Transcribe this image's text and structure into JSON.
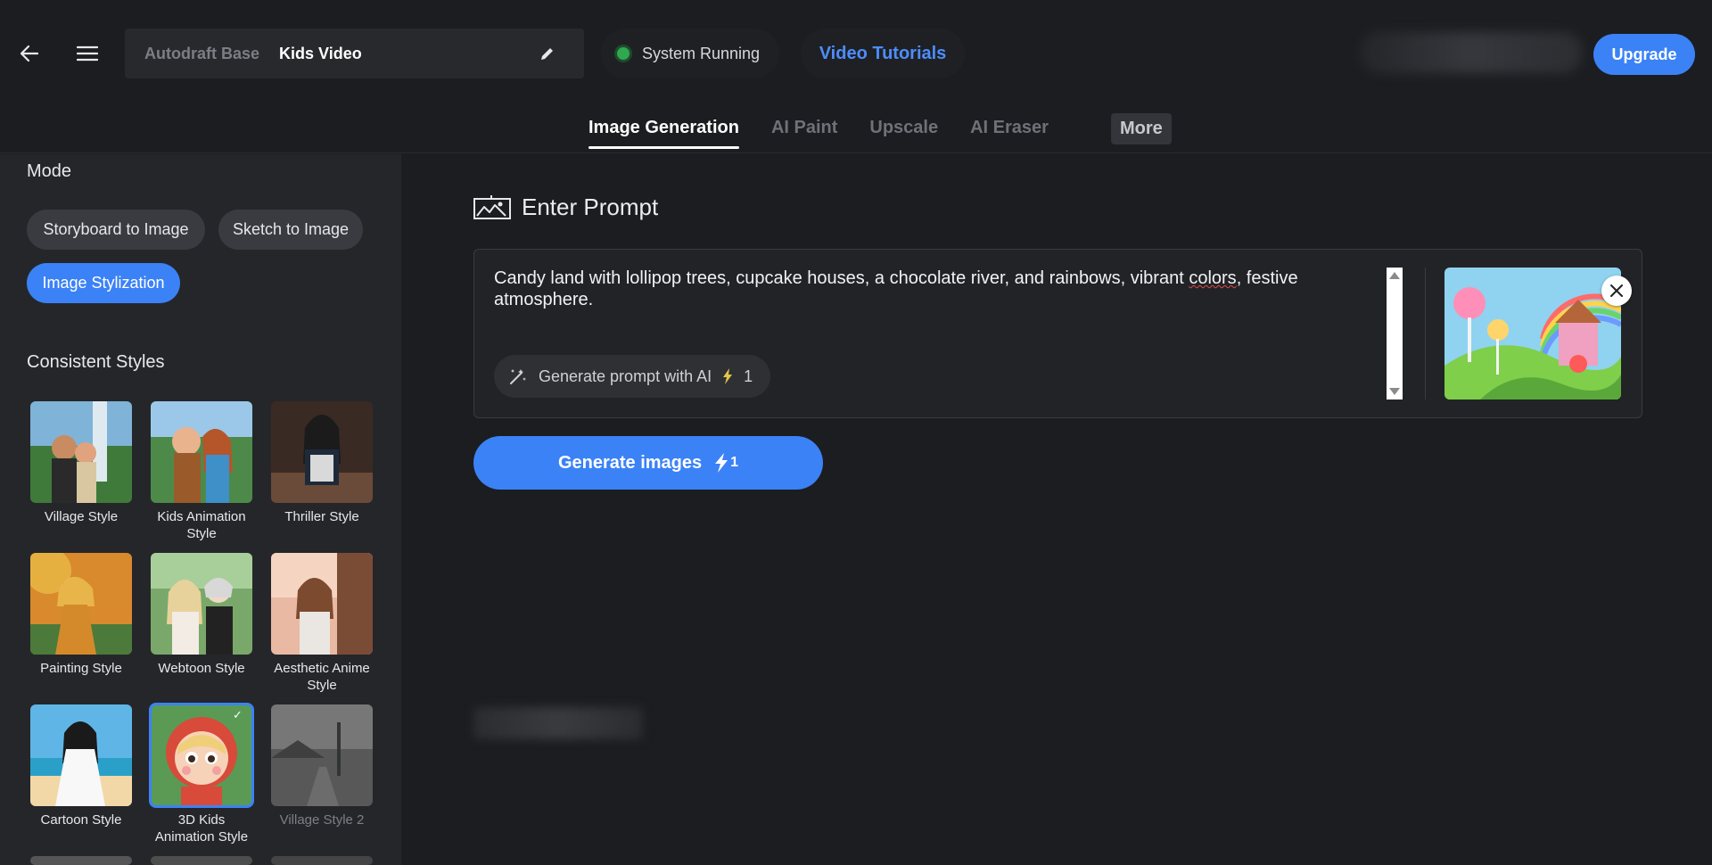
{
  "header": {
    "breadcrumb_base": "Autodraft Base",
    "project_name": "Kids Video",
    "status_text": "System Running",
    "tutorials_label": "Video Tutorials",
    "upgrade_label": "Upgrade"
  },
  "tabs": [
    {
      "label": "Image Generation",
      "active": true
    },
    {
      "label": "AI Paint"
    },
    {
      "label": "Upscale"
    },
    {
      "label": "AI Eraser"
    },
    {
      "label": "More"
    }
  ],
  "sidebar": {
    "mode_title": "Mode",
    "modes": [
      {
        "label": "Storyboard to Image"
      },
      {
        "label": "Sketch to Image"
      },
      {
        "label": "Image Stylization",
        "selected": true
      }
    ],
    "styles_title": "Consistent Styles",
    "styles": [
      {
        "label": "Village Style"
      },
      {
        "label": "Kids Animation Style"
      },
      {
        "label": "Thriller Style"
      },
      {
        "label": "Painting Style"
      },
      {
        "label": "Webtoon Style"
      },
      {
        "label": "Aesthetic Anime Style"
      },
      {
        "label": "Cartoon Style"
      },
      {
        "label": "3D Kids Animation Style",
        "selected": true
      },
      {
        "label": "Village Style 2"
      }
    ]
  },
  "main": {
    "prompt_title": "Enter Prompt",
    "prompt_text_before": "Candy land with lollipop trees, cupcake houses, a chocolate river, and rainbows, vibrant ",
    "prompt_text_misspelled": "colors",
    "prompt_text_after": ", festive atmosphere.",
    "gen_prompt_label": "Generate prompt with AI",
    "gen_prompt_cost": "1",
    "generate_label": "Generate images",
    "generate_cost": "1"
  },
  "colors": {
    "accent": "#3b82f6",
    "status_ok": "#2fa84f",
    "background": "#1c1d20",
    "sidebar": "#25262a"
  }
}
